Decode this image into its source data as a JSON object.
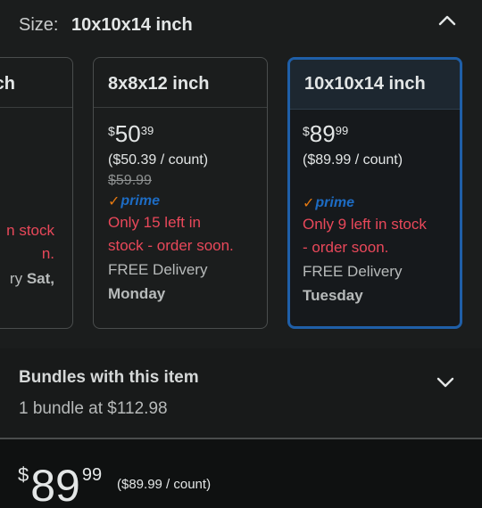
{
  "size_selector": {
    "label": "Size:",
    "selected": "10x10x14 inch"
  },
  "options": [
    {
      "title": "ch",
      "stock_line1": "n stock",
      "stock_line2": "n.",
      "delivery_prefix": "ry",
      "delivery_day": "Sat,"
    },
    {
      "title": "8x8x12 inch",
      "currency": "$",
      "price_whole": "50",
      "price_fraction": "39",
      "per_count": "($50.39 / count)",
      "list_price": "$59.99",
      "prime": "prime",
      "stock_line1": "Only 15 left in",
      "stock_line2": "stock - order soon.",
      "delivery_label": "FREE Delivery",
      "delivery_day": "Monday"
    },
    {
      "title": "10x10x14 inch",
      "currency": "$",
      "price_whole": "89",
      "price_fraction": "99",
      "per_count": "($89.99 / count)",
      "prime": "prime",
      "stock_line1": "Only 9 left in stock",
      "stock_line2": "- order soon.",
      "delivery_label": "FREE Delivery",
      "delivery_day": "Tuesday",
      "selected": true
    }
  ],
  "bundles": {
    "title": "Bundles with this item",
    "subtitle": "1 bundle at $112.98"
  },
  "price_summary": {
    "currency": "$",
    "whole": "89",
    "fraction": "99",
    "per_count": "($89.99 / count)"
  },
  "colors": {
    "background": "#0f1111",
    "stock_warning": "#e9485a",
    "prime_blue": "#1d6cc4",
    "selected_border": "#1f5fa8"
  },
  "icons": {
    "collapse": "chevron-up-icon",
    "expand": "chevron-down-icon",
    "prime_check": "prime-check-icon"
  }
}
